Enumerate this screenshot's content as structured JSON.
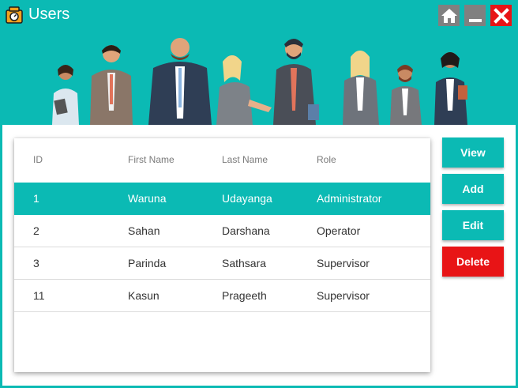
{
  "window": {
    "title": "Users"
  },
  "icons": {
    "app": "scale-icon",
    "home": "home-icon",
    "minimize": "minimize-icon",
    "close": "close-icon"
  },
  "colors": {
    "accent": "#0bbab4",
    "danger": "#e81416",
    "control_gray": "#808080"
  },
  "table": {
    "columns": [
      "ID",
      "First Name",
      "Last Name",
      "Role"
    ],
    "rows": [
      [
        "1",
        "Waruna",
        "Udayanga",
        "Administrator"
      ],
      [
        "2",
        "Sahan",
        "Darshana",
        "Operator"
      ],
      [
        "3",
        "Parinda",
        "Sathsara",
        "Supervisor"
      ],
      [
        "11",
        "Kasun",
        "Prageeth",
        "Supervisor"
      ]
    ],
    "selected_row": 0
  },
  "actions": {
    "view": "View",
    "add": "Add",
    "edit": "Edit",
    "delete": "Delete"
  }
}
